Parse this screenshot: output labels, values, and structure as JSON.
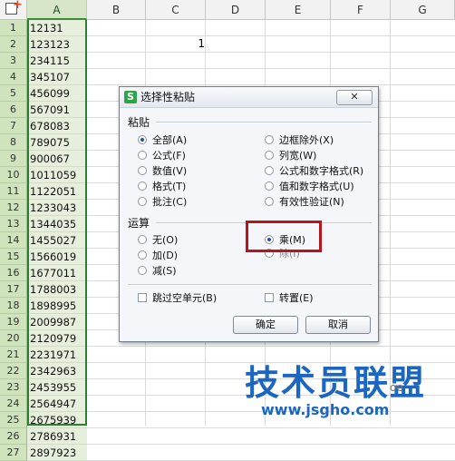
{
  "columns": [
    "A",
    "B",
    "C",
    "D",
    "E",
    "F",
    "G"
  ],
  "rows": [
    {
      "n": "1",
      "a": "12131"
    },
    {
      "n": "2",
      "a": "123123"
    },
    {
      "n": "3",
      "a": "234115"
    },
    {
      "n": "4",
      "a": "345107"
    },
    {
      "n": "5",
      "a": "456099"
    },
    {
      "n": "6",
      "a": "567091"
    },
    {
      "n": "7",
      "a": "678083"
    },
    {
      "n": "8",
      "a": "789075"
    },
    {
      "n": "9",
      "a": "900067"
    },
    {
      "n": "10",
      "a": "1011059"
    },
    {
      "n": "11",
      "a": "1122051"
    },
    {
      "n": "12",
      "a": "1233043"
    },
    {
      "n": "13",
      "a": "1344035"
    },
    {
      "n": "14",
      "a": "1455027"
    },
    {
      "n": "15",
      "a": "1566019"
    },
    {
      "n": "16",
      "a": "1677011"
    },
    {
      "n": "17",
      "a": "1788003"
    },
    {
      "n": "18",
      "a": "1898995"
    },
    {
      "n": "19",
      "a": "2009987"
    },
    {
      "n": "20",
      "a": "2120979"
    },
    {
      "n": "21",
      "a": "2231971"
    },
    {
      "n": "22",
      "a": "2342963"
    },
    {
      "n": "23",
      "a": "2453955"
    },
    {
      "n": "24",
      "a": "2564947"
    },
    {
      "n": "25",
      "a": "2675939"
    },
    {
      "n": "26",
      "a": "2786931"
    },
    {
      "n": "27",
      "a": "2897923"
    }
  ],
  "cell_c2": "1",
  "dialog": {
    "title": "选择性粘贴",
    "close": "✕",
    "paste_label": "粘贴",
    "paste_left": [
      "全部(A)",
      "公式(F)",
      "数值(V)",
      "格式(T)",
      "批注(C)"
    ],
    "paste_right": [
      "边框除外(X)",
      "列宽(W)",
      "公式和数字格式(R)",
      "值和数字格式(U)",
      "有效性验证(N)"
    ],
    "operation_label": "运算",
    "op_left": [
      "无(O)",
      "加(D)",
      "减(S)"
    ],
    "op_right": [
      "乘(M)",
      "除(I)"
    ],
    "skip_blanks": "跳过空单元(B)",
    "transpose": "转置(E)",
    "ok": "确定",
    "cancel": "取消"
  },
  "watermark": {
    "main": "技术员联盟",
    "url": "www.jsgho.com",
    "logo": "oe"
  },
  "colors": {
    "accent_green": "#2f7d2f",
    "highlight_red": "#b8141c",
    "watermark_blue": "#1a66c2"
  }
}
